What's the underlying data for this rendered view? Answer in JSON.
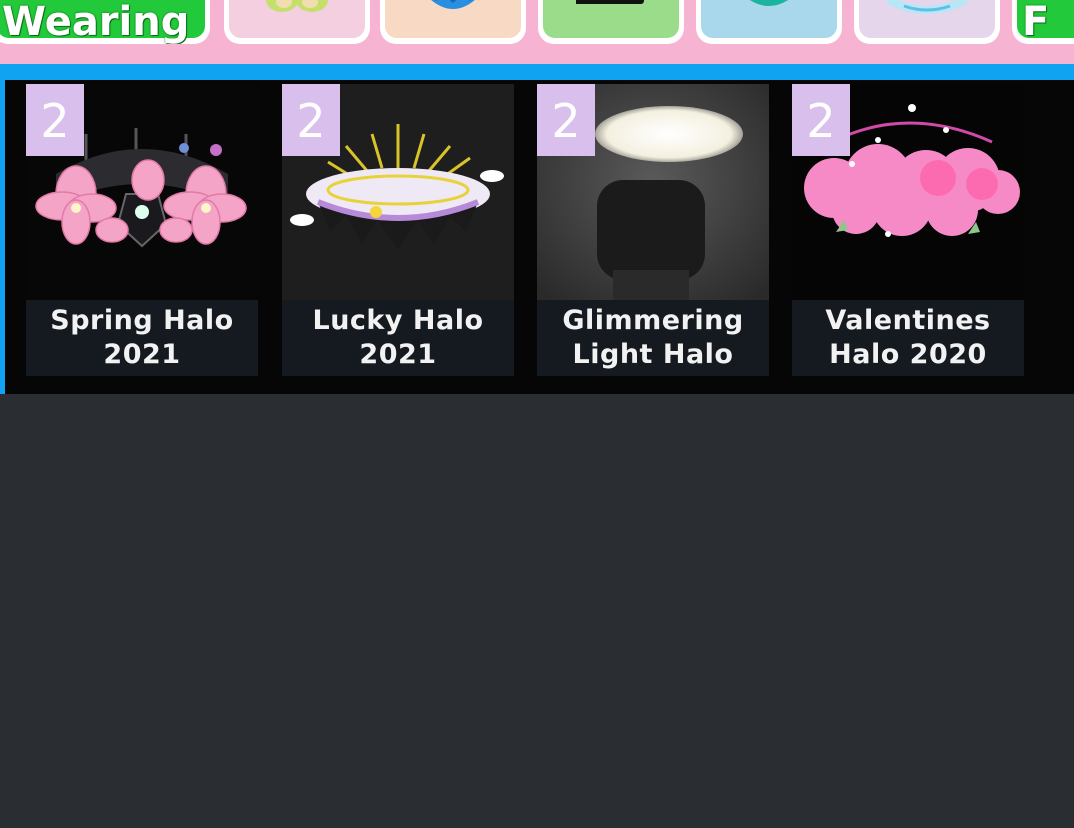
{
  "categories": {
    "wearing_label": "Wearing",
    "last_label": "F",
    "icons": [
      "wings-icon",
      "shell-icon",
      "hat-icon",
      "hair-icon",
      "crown-icon"
    ]
  },
  "items": [
    {
      "name": "Spring Halo 2021",
      "count": "2",
      "icon": "spring-halo-icon"
    },
    {
      "name": "Lucky Halo 2021",
      "count": "2",
      "icon": "lucky-halo-icon"
    },
    {
      "name": "Glimmering Light Halo",
      "count": "2",
      "icon": "glimmering-halo-icon"
    },
    {
      "name": "Valentines Halo 2020",
      "count": "2",
      "icon": "valentines-halo-icon"
    }
  ],
  "colors": {
    "tab_bar": "#f6b3d2",
    "accent_blue": "#0fa3f1",
    "wearing_green": "#22c93a",
    "badge": "#d9c0ec",
    "background": "#2a2d31"
  }
}
